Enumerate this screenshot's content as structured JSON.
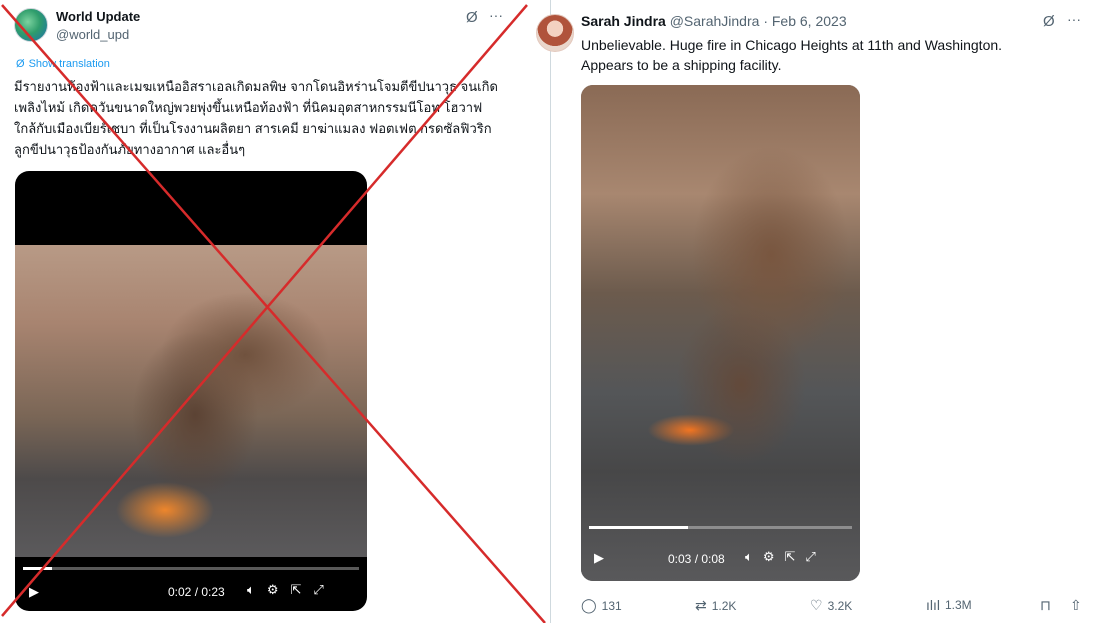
{
  "left_tweet": {
    "author_name": "World Update",
    "author_handle": "@world_upd",
    "show_translation": "Show translation",
    "text": "มีรายงานท้องฟ้าและเมฆเหนืออิสราเอลเกิดมลพิษ จากโดนอิหร่านโจมตีขีปนาวุธ จนเกิดเพลิงไหม้ เกิดควันขนาดใหญ่พวยพุ่งขึ้นเหนือท้องฟ้า ที่นิคมอุตสาหกรรมนีโอท โฮวาฟ ใกล้กับเมืองเบียร์เชบา ที่เป็นโรงงานผลิตยา สารเคมี ยาฆ่าแมลง ฟอตเฟต กรดซัลฟิวริก ลูกขีปนาวุธป้องกันภัยทางอากาศ และอื่นๆ",
    "video": {
      "time": "0:02 / 0:23",
      "progress": 0.087
    },
    "cross_color": "#d62b2b"
  },
  "right_tweet": {
    "author_name": "Sarah Jindra",
    "author_handle": "@SarahJindra",
    "separator": "·",
    "date": "Feb 6, 2023",
    "text": "Unbelievable. Huge fire in Chicago Heights at 11th and Washington. Appears to be a shipping facility.",
    "video": {
      "time": "0:03 / 0:08",
      "progress": 0.375
    },
    "stats": {
      "replies": "131",
      "reposts": "1.2K",
      "likes": "3.2K",
      "views": "1.3M"
    }
  },
  "icons": [
    "grok-icon",
    "more-icon",
    "translate-icon",
    "play-icon",
    "volume-icon",
    "settings-icon",
    "pip-icon",
    "fullscreen-icon",
    "reply-icon",
    "repost-icon",
    "like-icon",
    "views-icon",
    "bookmark-icon",
    "share-icon"
  ],
  "colors": {
    "link": "#1d9bf0",
    "muted": "#536471",
    "text": "#0f1419"
  }
}
